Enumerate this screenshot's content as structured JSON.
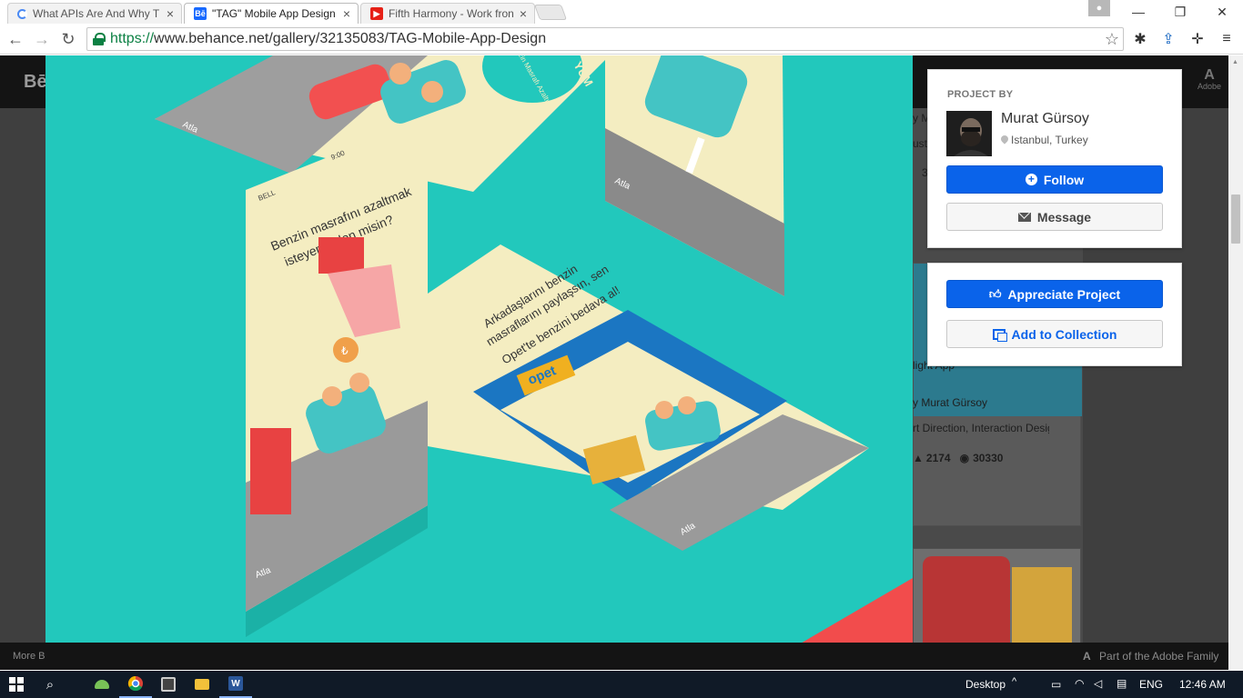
{
  "browser": {
    "tabs": [
      {
        "title": "What APIs Are And Why T",
        "favicon": "loading-icon"
      },
      {
        "title": "\"TAG\" Mobile App Design",
        "favicon": "behance-icon",
        "active": true
      },
      {
        "title": "Fifth Harmony - Work fron",
        "favicon": "youtube-icon"
      }
    ],
    "url_scheme": "https://",
    "url_rest": "www.behance.net/gallery/32135083/TAG-Mobile-App-Design"
  },
  "page": {
    "logo": "Bē",
    "adobe_label": "Adobe",
    "footer_left": "More B",
    "footer_right": "Part of the Adobe Family",
    "related": {
      "snippet_1": "y M",
      "snippet_2": "ust",
      "snippet_3": "3",
      "title": "light App",
      "by": "y  Murat Gürsoy",
      "fields": "rt Direction, Interaction Desig...",
      "appreciations": "2174",
      "views": "30330"
    }
  },
  "artwork": {
    "screen_a_question": "Benzin masrafını azaltmak isteyenlerden misin?",
    "screen_a_status": "BELL",
    "screen_a_time": "9:00",
    "screen_a_skip": "Atla",
    "screen_b_text": "Arkadaşlarını benzin masraflarını paylaşsın, sen Opet'te benzini bedava al!",
    "screen_b_time": "9:00",
    "screen_b_brand": "opet",
    "screen_b_skip": "Atla",
    "screen_c_skip": "Atla",
    "screen_d_skip": "Atla",
    "bubble_text": "Benzin Masrafı Azaltırım",
    "corner_text": "YÜM",
    "coin_symbol": "₺"
  },
  "sidebar": {
    "project_by_label": "PROJECT BY",
    "author_name": "Murat Gürsoy",
    "author_location": "Istanbul, Turkey",
    "follow_label": "Follow",
    "message_label": "Message",
    "appreciate_label": "Appreciate Project",
    "add_collection_label": "Add to Collection"
  },
  "taskbar": {
    "desktop_label": "Desktop",
    "language": "ENG",
    "time": "12:46 AM"
  },
  "colors": {
    "accent_blue": "#0a63ea",
    "teal_bg": "#22c8bc",
    "page_dark": "#3f3f3f"
  }
}
